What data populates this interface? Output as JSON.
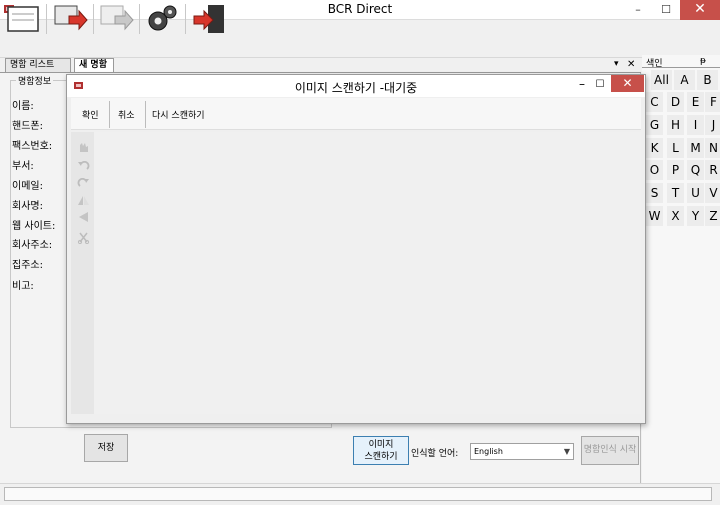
{
  "window": {
    "title": "BCR Direct",
    "minimize": "–",
    "maximize": "☐",
    "close": "✕"
  },
  "toolbar": {
    "icons": [
      "new-card-icon",
      "import-icon",
      "export-icon",
      "settings-icon",
      "exit-icon"
    ]
  },
  "tabs": {
    "list": "명함 리스트",
    "new": "새 명함",
    "pin": "▾",
    "close": "✕"
  },
  "card": {
    "group_title": "명함정보",
    "fields": [
      "이름:",
      "핸드폰:",
      "팩스번호:",
      "부서:",
      "이메일:",
      "회사명:",
      "웹 사이트:",
      "회사주소:",
      "집주소:",
      "비고:"
    ]
  },
  "bottom": {
    "save": "저장",
    "scan_line1": "이미지",
    "scan_line2": "스캔하기",
    "lang_label": "인식할 언어:",
    "lang_value": "English",
    "recognize": "명함인식 시작"
  },
  "index": {
    "title": "색인",
    "pin": "ᵽ",
    "letters": [
      "All",
      "A",
      "B",
      "C",
      "D",
      "E",
      "F",
      "G",
      "H",
      "I",
      "J",
      "K",
      "L",
      "M",
      "N",
      "O",
      "P",
      "Q",
      "R",
      "S",
      "T",
      "U",
      "V",
      "W",
      "X",
      "Y",
      "Z"
    ]
  },
  "dialog": {
    "title": "이미지 스캔하기 -대기중",
    "minimize": "–",
    "maximize": "☐",
    "close": "✕",
    "confirm": "확인",
    "cancel": "취소",
    "rescan": "다시 스캔하기",
    "side_icons": [
      "hand-icon",
      "rotate-left-icon",
      "rotate-right-icon",
      "flip-vertical-icon",
      "flip-horizontal-icon",
      "crop-icon"
    ]
  },
  "colors": {
    "close_red": "#c7504a",
    "scan_button_border": "#3c7fb1",
    "scan_button_bg": "#e5f1fb"
  }
}
